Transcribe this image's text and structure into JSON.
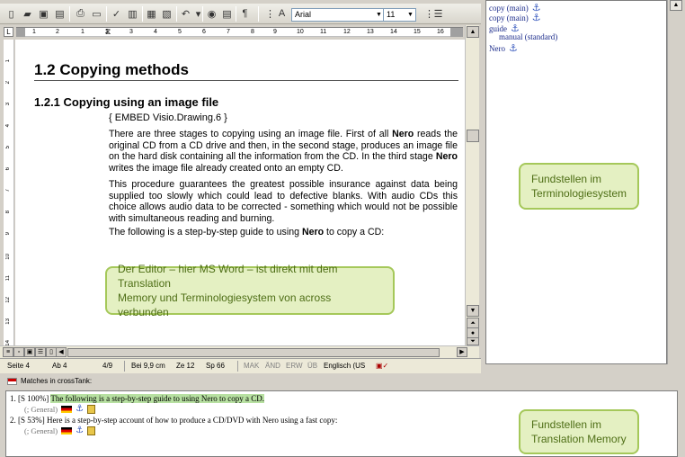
{
  "word": {
    "toolbar": {
      "font_name": "Arial",
      "font_size": "11"
    },
    "ruler_numbers": [
      "1",
      "2",
      "1",
      "2",
      "3",
      "4",
      "5",
      "6",
      "7",
      "8",
      "9",
      "10",
      "11",
      "12",
      "13",
      "14",
      "15",
      "16"
    ],
    "vruler_numbers": [
      "1",
      "2",
      "3",
      "4",
      "5",
      "6",
      "7",
      "8",
      "9",
      "10",
      "11",
      "12",
      "13",
      "14"
    ],
    "document": {
      "heading1": "1.2 Copying methods",
      "heading2": "1.2.1 Copying using an image file",
      "embed_field": "{ EMBED Visio.Drawing.6 }",
      "para1": {
        "t1": "There are three stages to copying using an image file. First of all ",
        "b1": "Nero",
        "t2": " reads the original CD from a CD drive and then, in the second stage, produces an image file on the hard disk containing all the information from the CD. In the third stage ",
        "b2": "Nero",
        "t3": " writes the image file already created onto an empty CD."
      },
      "para2": "This procedure guarantees the greatest possible insurance against data being supplied too slowly which could lead to defective blanks. With audio CDs this choice allows audio data to be corrected - something which would not be possible with simultaneous reading and burning.",
      "para3": {
        "t1": "The following is a step-by-step guide to using ",
        "b1": "Nero",
        "t2": " to copy a CD:"
      }
    },
    "status": {
      "page": "Seite 4",
      "section": "Ab 4",
      "pages": "4/9",
      "position": "Bei 9,9 cm",
      "line": "Ze 12",
      "column": "Sp 66",
      "mak": "MAK",
      "and": "ÄND",
      "erw": "ERW",
      "ub": "ÜB",
      "language": "Englisch (US"
    }
  },
  "terminology": {
    "rows": [
      {
        "text": "copy (main)",
        "anchor": true,
        "indent": false
      },
      {
        "text": "copy (main)",
        "anchor": true,
        "indent": false
      },
      {
        "text": "guide",
        "anchor": true,
        "indent": false
      },
      {
        "text": "manual (standard)",
        "anchor": false,
        "indent": true
      },
      {
        "text": "Nero",
        "anchor": true,
        "indent": false
      }
    ]
  },
  "crosstank": {
    "title": "Matches in crossTank:",
    "matches": [
      {
        "prefix": "1. [S 100%] ",
        "text": "The following is a step-by-step guide to using Nero to copy a CD.",
        "highlighted": true,
        "meta": "(; General)"
      },
      {
        "prefix": "2. [S 53%] ",
        "text": "Here is a step-by-step account of how to produce a CD/DVD with Nero using a fast copy:",
        "highlighted": false,
        "meta": "(; General)"
      }
    ]
  },
  "callouts": {
    "editor": {
      "line1": "Der Editor – hier MS Word – ist direkt mit dem Translation",
      "line2": "Memory und Terminologiesystem von across verbunden"
    },
    "terminology": {
      "line1": "Fundstellen im",
      "line2": "Terminologiesystem"
    },
    "memory": {
      "line1": "Fundstellen im",
      "line2": "Translation Memory"
    }
  },
  "colors": {
    "callout_bg": "#e4f0c2",
    "callout_border": "#a5c85a",
    "callout_text": "#4e6e16",
    "match_highlight": "#b7e0a1",
    "term_text": "#1a2a8a"
  }
}
